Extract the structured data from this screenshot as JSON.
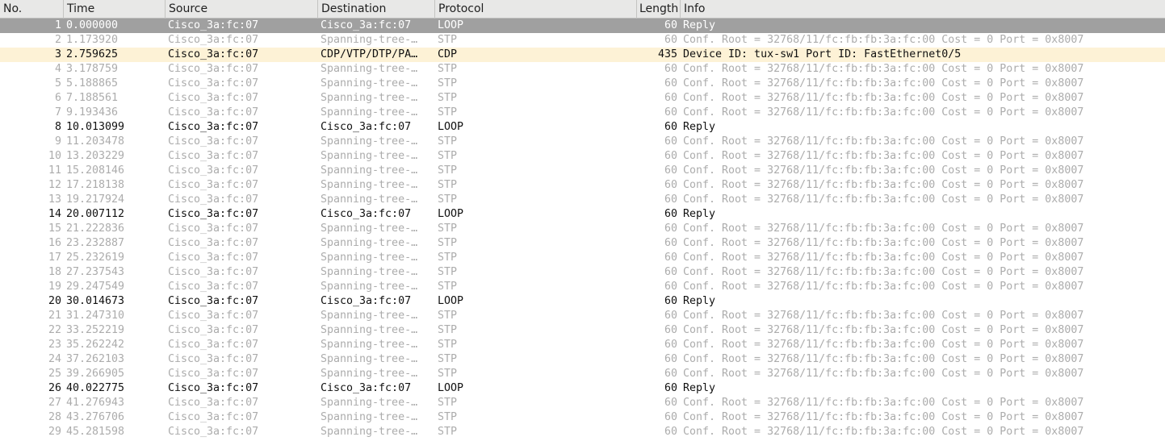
{
  "columns": {
    "no": "No.",
    "time": "Time",
    "source": "Source",
    "destination": "Destination",
    "protocol": "Protocol",
    "length": "Length",
    "info": "Info"
  },
  "colors": {
    "selected_bg": "#a0a0a0",
    "highlight_bg": "#fdf2d6",
    "dim_text": "#acacac",
    "normal_text": "#111111"
  },
  "packets": [
    {
      "no": "1",
      "time": "0.000000",
      "source": "Cisco_3a:fc:07",
      "destination": "Cisco_3a:fc:07",
      "protocol": "LOOP",
      "length": "60",
      "info": "Reply",
      "style": "sel"
    },
    {
      "no": "2",
      "time": "1.173920",
      "source": "Cisco_3a:fc:07",
      "destination": "Spanning-tree-…",
      "protocol": "STP",
      "length": "60",
      "info": "Conf. Root = 32768/11/fc:fb:fb:3a:fc:00  Cost = 0  Port = 0x8007",
      "style": "dim"
    },
    {
      "no": "3",
      "time": "2.759625",
      "source": "Cisco_3a:fc:07",
      "destination": "CDP/VTP/DTP/PA…",
      "protocol": "CDP",
      "length": "435",
      "info": "Device ID: tux-sw1  Port ID: FastEthernet0/5",
      "style": "hl"
    },
    {
      "no": "4",
      "time": "3.178759",
      "source": "Cisco_3a:fc:07",
      "destination": "Spanning-tree-…",
      "protocol": "STP",
      "length": "60",
      "info": "Conf. Root = 32768/11/fc:fb:fb:3a:fc:00  Cost = 0  Port = 0x8007",
      "style": "dim"
    },
    {
      "no": "5",
      "time": "5.188865",
      "source": "Cisco_3a:fc:07",
      "destination": "Spanning-tree-…",
      "protocol": "STP",
      "length": "60",
      "info": "Conf. Root = 32768/11/fc:fb:fb:3a:fc:00  Cost = 0  Port = 0x8007",
      "style": "dim"
    },
    {
      "no": "6",
      "time": "7.188561",
      "source": "Cisco_3a:fc:07",
      "destination": "Spanning-tree-…",
      "protocol": "STP",
      "length": "60",
      "info": "Conf. Root = 32768/11/fc:fb:fb:3a:fc:00  Cost = 0  Port = 0x8007",
      "style": "dim"
    },
    {
      "no": "7",
      "time": "9.193436",
      "source": "Cisco_3a:fc:07",
      "destination": "Spanning-tree-…",
      "protocol": "STP",
      "length": "60",
      "info": "Conf. Root = 32768/11/fc:fb:fb:3a:fc:00  Cost = 0  Port = 0x8007",
      "style": "dim"
    },
    {
      "no": "8",
      "time": "10.013099",
      "source": "Cisco_3a:fc:07",
      "destination": "Cisco_3a:fc:07",
      "protocol": "LOOP",
      "length": "60",
      "info": "Reply",
      "style": "norm"
    },
    {
      "no": "9",
      "time": "11.203478",
      "source": "Cisco_3a:fc:07",
      "destination": "Spanning-tree-…",
      "protocol": "STP",
      "length": "60",
      "info": "Conf. Root = 32768/11/fc:fb:fb:3a:fc:00  Cost = 0  Port = 0x8007",
      "style": "dim"
    },
    {
      "no": "10",
      "time": "13.203229",
      "source": "Cisco_3a:fc:07",
      "destination": "Spanning-tree-…",
      "protocol": "STP",
      "length": "60",
      "info": "Conf. Root = 32768/11/fc:fb:fb:3a:fc:00  Cost = 0  Port = 0x8007",
      "style": "dim"
    },
    {
      "no": "11",
      "time": "15.208146",
      "source": "Cisco_3a:fc:07",
      "destination": "Spanning-tree-…",
      "protocol": "STP",
      "length": "60",
      "info": "Conf. Root = 32768/11/fc:fb:fb:3a:fc:00  Cost = 0  Port = 0x8007",
      "style": "dim"
    },
    {
      "no": "12",
      "time": "17.218138",
      "source": "Cisco_3a:fc:07",
      "destination": "Spanning-tree-…",
      "protocol": "STP",
      "length": "60",
      "info": "Conf. Root = 32768/11/fc:fb:fb:3a:fc:00  Cost = 0  Port = 0x8007",
      "style": "dim"
    },
    {
      "no": "13",
      "time": "19.217924",
      "source": "Cisco_3a:fc:07",
      "destination": "Spanning-tree-…",
      "protocol": "STP",
      "length": "60",
      "info": "Conf. Root = 32768/11/fc:fb:fb:3a:fc:00  Cost = 0  Port = 0x8007",
      "style": "dim"
    },
    {
      "no": "14",
      "time": "20.007112",
      "source": "Cisco_3a:fc:07",
      "destination": "Cisco_3a:fc:07",
      "protocol": "LOOP",
      "length": "60",
      "info": "Reply",
      "style": "norm"
    },
    {
      "no": "15",
      "time": "21.222836",
      "source": "Cisco_3a:fc:07",
      "destination": "Spanning-tree-…",
      "protocol": "STP",
      "length": "60",
      "info": "Conf. Root = 32768/11/fc:fb:fb:3a:fc:00  Cost = 0  Port = 0x8007",
      "style": "dim"
    },
    {
      "no": "16",
      "time": "23.232887",
      "source": "Cisco_3a:fc:07",
      "destination": "Spanning-tree-…",
      "protocol": "STP",
      "length": "60",
      "info": "Conf. Root = 32768/11/fc:fb:fb:3a:fc:00  Cost = 0  Port = 0x8007",
      "style": "dim"
    },
    {
      "no": "17",
      "time": "25.232619",
      "source": "Cisco_3a:fc:07",
      "destination": "Spanning-tree-…",
      "protocol": "STP",
      "length": "60",
      "info": "Conf. Root = 32768/11/fc:fb:fb:3a:fc:00  Cost = 0  Port = 0x8007",
      "style": "dim"
    },
    {
      "no": "18",
      "time": "27.237543",
      "source": "Cisco_3a:fc:07",
      "destination": "Spanning-tree-…",
      "protocol": "STP",
      "length": "60",
      "info": "Conf. Root = 32768/11/fc:fb:fb:3a:fc:00  Cost = 0  Port = 0x8007",
      "style": "dim"
    },
    {
      "no": "19",
      "time": "29.247549",
      "source": "Cisco_3a:fc:07",
      "destination": "Spanning-tree-…",
      "protocol": "STP",
      "length": "60",
      "info": "Conf. Root = 32768/11/fc:fb:fb:3a:fc:00  Cost = 0  Port = 0x8007",
      "style": "dim"
    },
    {
      "no": "20",
      "time": "30.014673",
      "source": "Cisco_3a:fc:07",
      "destination": "Cisco_3a:fc:07",
      "protocol": "LOOP",
      "length": "60",
      "info": "Reply",
      "style": "norm"
    },
    {
      "no": "21",
      "time": "31.247310",
      "source": "Cisco_3a:fc:07",
      "destination": "Spanning-tree-…",
      "protocol": "STP",
      "length": "60",
      "info": "Conf. Root = 32768/11/fc:fb:fb:3a:fc:00  Cost = 0  Port = 0x8007",
      "style": "dim"
    },
    {
      "no": "22",
      "time": "33.252219",
      "source": "Cisco_3a:fc:07",
      "destination": "Spanning-tree-…",
      "protocol": "STP",
      "length": "60",
      "info": "Conf. Root = 32768/11/fc:fb:fb:3a:fc:00  Cost = 0  Port = 0x8007",
      "style": "dim"
    },
    {
      "no": "23",
      "time": "35.262242",
      "source": "Cisco_3a:fc:07",
      "destination": "Spanning-tree-…",
      "protocol": "STP",
      "length": "60",
      "info": "Conf. Root = 32768/11/fc:fb:fb:3a:fc:00  Cost = 0  Port = 0x8007",
      "style": "dim"
    },
    {
      "no": "24",
      "time": "37.262103",
      "source": "Cisco_3a:fc:07",
      "destination": "Spanning-tree-…",
      "protocol": "STP",
      "length": "60",
      "info": "Conf. Root = 32768/11/fc:fb:fb:3a:fc:00  Cost = 0  Port = 0x8007",
      "style": "dim"
    },
    {
      "no": "25",
      "time": "39.266905",
      "source": "Cisco_3a:fc:07",
      "destination": "Spanning-tree-…",
      "protocol": "STP",
      "length": "60",
      "info": "Conf. Root = 32768/11/fc:fb:fb:3a:fc:00  Cost = 0  Port = 0x8007",
      "style": "dim"
    },
    {
      "no": "26",
      "time": "40.022775",
      "source": "Cisco_3a:fc:07",
      "destination": "Cisco_3a:fc:07",
      "protocol": "LOOP",
      "length": "60",
      "info": "Reply",
      "style": "norm"
    },
    {
      "no": "27",
      "time": "41.276943",
      "source": "Cisco_3a:fc:07",
      "destination": "Spanning-tree-…",
      "protocol": "STP",
      "length": "60",
      "info": "Conf. Root = 32768/11/fc:fb:fb:3a:fc:00  Cost = 0  Port = 0x8007",
      "style": "dim"
    },
    {
      "no": "28",
      "time": "43.276706",
      "source": "Cisco_3a:fc:07",
      "destination": "Spanning-tree-…",
      "protocol": "STP",
      "length": "60",
      "info": "Conf. Root = 32768/11/fc:fb:fb:3a:fc:00  Cost = 0  Port = 0x8007",
      "style": "dim"
    },
    {
      "no": "29",
      "time": "45.281598",
      "source": "Cisco_3a:fc:07",
      "destination": "Spanning-tree-…",
      "protocol": "STP",
      "length": "60",
      "info": "Conf. Root = 32768/11/fc:fb:fb:3a:fc:00  Cost = 0  Port = 0x8007",
      "style": "dim"
    }
  ]
}
